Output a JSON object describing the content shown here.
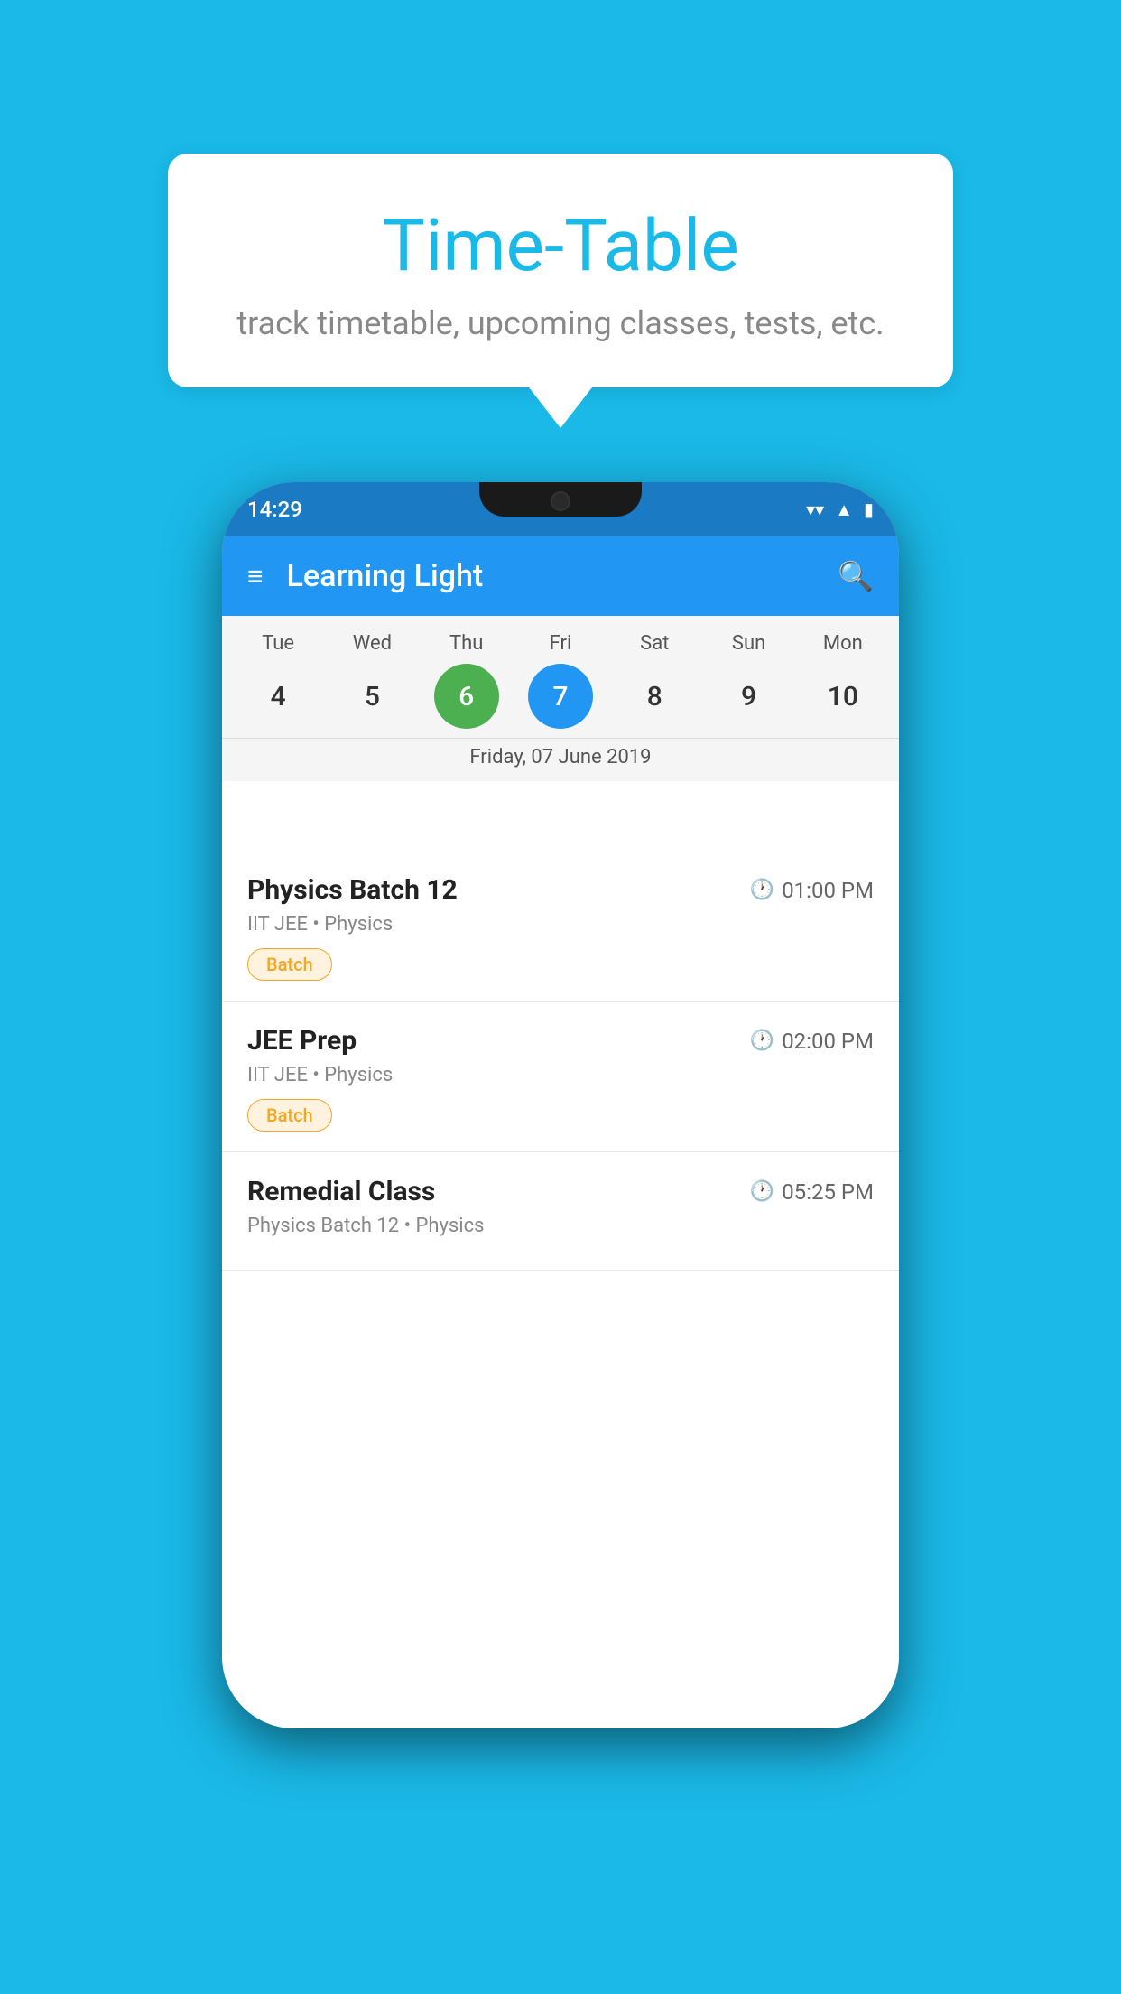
{
  "background_color": "#1ab9e8",
  "speech_bubble": {
    "title": "Time-Table",
    "subtitle": "track timetable, upcoming classes, tests, etc."
  },
  "phone": {
    "status_bar": {
      "time": "14:29",
      "wifi_icon": "▼",
      "signal_icon": "▲",
      "battery_icon": "▮"
    },
    "app_bar": {
      "title": "Learning Light",
      "menu_icon": "≡",
      "search_icon": "🔍"
    },
    "calendar": {
      "days": [
        {
          "label": "Tue",
          "number": "4"
        },
        {
          "label": "Wed",
          "number": "5"
        },
        {
          "label": "Thu",
          "number": "6",
          "state": "today"
        },
        {
          "label": "Fri",
          "number": "7",
          "state": "selected"
        },
        {
          "label": "Sat",
          "number": "8"
        },
        {
          "label": "Sun",
          "number": "9"
        },
        {
          "label": "Mon",
          "number": "10"
        }
      ],
      "selected_date": "Friday, 07 June 2019"
    },
    "classes": [
      {
        "name": "Physics Batch 12",
        "time": "01:00 PM",
        "meta": "IIT JEE • Physics",
        "badge": "Batch"
      },
      {
        "name": "JEE Prep",
        "time": "02:00 PM",
        "meta": "IIT JEE • Physics",
        "badge": "Batch"
      },
      {
        "name": "Remedial Class",
        "time": "05:25 PM",
        "meta": "Physics Batch 12 • Physics",
        "badge": null
      }
    ]
  }
}
